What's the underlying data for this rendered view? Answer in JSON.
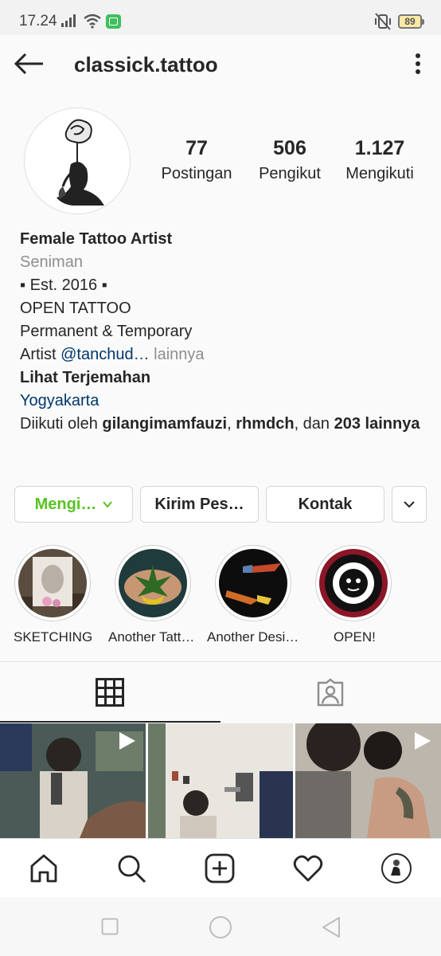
{
  "status_bar": {
    "time": "17.24",
    "battery": "89"
  },
  "header": {
    "username": "classick.tattoo"
  },
  "stats": [
    {
      "value": "77",
      "label": "Postingan"
    },
    {
      "value": "506",
      "label": "Pengikut"
    },
    {
      "value": "1.127",
      "label": "Mengikuti"
    }
  ],
  "bio": {
    "name": "Female Tattoo Artist",
    "category": "Seniman",
    "line1": "▪ Est. 2016 ▪",
    "line2": "OPEN TATTOO",
    "line3": "Permanent & Temporary",
    "line4_prefix": "Artist ",
    "line4_mention": "@tanchud…",
    "line4_more": " lainnya",
    "translate": "Lihat Terjemahan",
    "location": "Yogyakarta",
    "followed_prefix": "Diikuti oleh ",
    "followed_user1": "gilangimamfauzi",
    "followed_sep": ", ",
    "followed_user2": "rhmdch",
    "followed_and": ", dan ",
    "followed_count": "203 lainnya"
  },
  "actions": {
    "follow": "Mengi…",
    "message": "Kirim Pes…",
    "contact": "Kontak"
  },
  "highlights": [
    {
      "label": "SKETCHING"
    },
    {
      "label": "Another Tatt…"
    },
    {
      "label": "Another Desi…"
    },
    {
      "label": "OPEN!"
    }
  ],
  "colors": {
    "following_green": "#58c322",
    "link_blue": "#00376b",
    "muted": "#8e8e8e"
  }
}
